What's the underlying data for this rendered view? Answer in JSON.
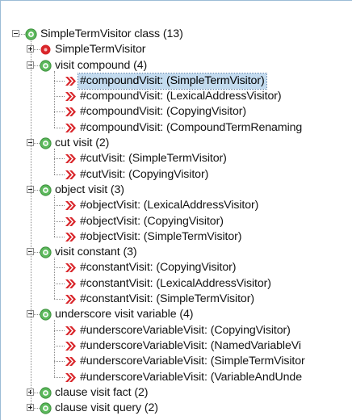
{
  "tree": {
    "root": {
      "label": "SimpleTermVisitor class (13)",
      "icon": "green-circle-icon",
      "expanded": true
    },
    "items": [
      {
        "label": "SimpleTermVisitor",
        "icon": "red-class-icon",
        "level": 1,
        "expander": "plus"
      },
      {
        "label": "visit compound (4)",
        "icon": "green-circle-icon",
        "level": 1,
        "expander": "minus"
      },
      {
        "label": "#compoundVisit: (SimpleTermVisitor)",
        "icon": "red-chevron-icon",
        "level": 2,
        "selected": true
      },
      {
        "label": "#compoundVisit: (LexicalAddressVisitor)",
        "icon": "red-chevron-icon",
        "level": 2
      },
      {
        "label": "#compoundVisit: (CopyingVisitor)",
        "icon": "red-chevron-icon",
        "level": 2
      },
      {
        "label": "#compoundVisit: (CompoundTermRenaming",
        "icon": "red-chevron-icon",
        "level": 2
      },
      {
        "label": "cut visit (2)",
        "icon": "green-circle-icon",
        "level": 1,
        "expander": "minus"
      },
      {
        "label": "#cutVisit: (SimpleTermVisitor)",
        "icon": "red-chevron-icon",
        "level": 2
      },
      {
        "label": "#cutVisit: (CopyingVisitor)",
        "icon": "red-chevron-icon",
        "level": 2
      },
      {
        "label": "object visit (3)",
        "icon": "green-circle-icon",
        "level": 1,
        "expander": "minus"
      },
      {
        "label": "#objectVisit: (LexicalAddressVisitor)",
        "icon": "red-chevron-icon",
        "level": 2
      },
      {
        "label": "#objectVisit: (CopyingVisitor)",
        "icon": "red-chevron-icon",
        "level": 2
      },
      {
        "label": "#objectVisit: (SimpleTermVisitor)",
        "icon": "red-chevron-icon",
        "level": 2
      },
      {
        "label": "visit constant (3)",
        "icon": "green-circle-icon",
        "level": 1,
        "expander": "minus"
      },
      {
        "label": "#constantVisit: (CopyingVisitor)",
        "icon": "red-chevron-icon",
        "level": 2
      },
      {
        "label": "#constantVisit: (LexicalAddressVisitor)",
        "icon": "red-chevron-icon",
        "level": 2
      },
      {
        "label": "#constantVisit: (SimpleTermVisitor)",
        "icon": "red-chevron-icon",
        "level": 2
      },
      {
        "label": "underscore visit variable (4)",
        "icon": "green-circle-icon",
        "level": 1,
        "expander": "minus"
      },
      {
        "label": "#underscoreVariableVisit: (CopyingVisitor)",
        "icon": "red-chevron-icon",
        "level": 2
      },
      {
        "label": "#underscoreVariableVisit: (NamedVariableVi",
        "icon": "red-chevron-icon",
        "level": 2
      },
      {
        "label": "#underscoreVariableVisit: (SimpleTermVisitor",
        "icon": "red-chevron-icon",
        "level": 2
      },
      {
        "label": "#underscoreVariableVisit: (VariableAndUnde",
        "icon": "red-chevron-icon",
        "level": 2
      },
      {
        "label": "clause visit fact (2)",
        "icon": "green-circle-icon",
        "level": 1,
        "expander": "plus"
      },
      {
        "label": "clause visit query (2)",
        "icon": "green-circle-icon",
        "level": 1,
        "expander": "plus"
      }
    ]
  },
  "colors": {
    "green_icon": "#5cb85c",
    "red_icon": "#d9262b",
    "selection_bg": "#c3dbef",
    "tree_line": "#8a8a8a"
  }
}
